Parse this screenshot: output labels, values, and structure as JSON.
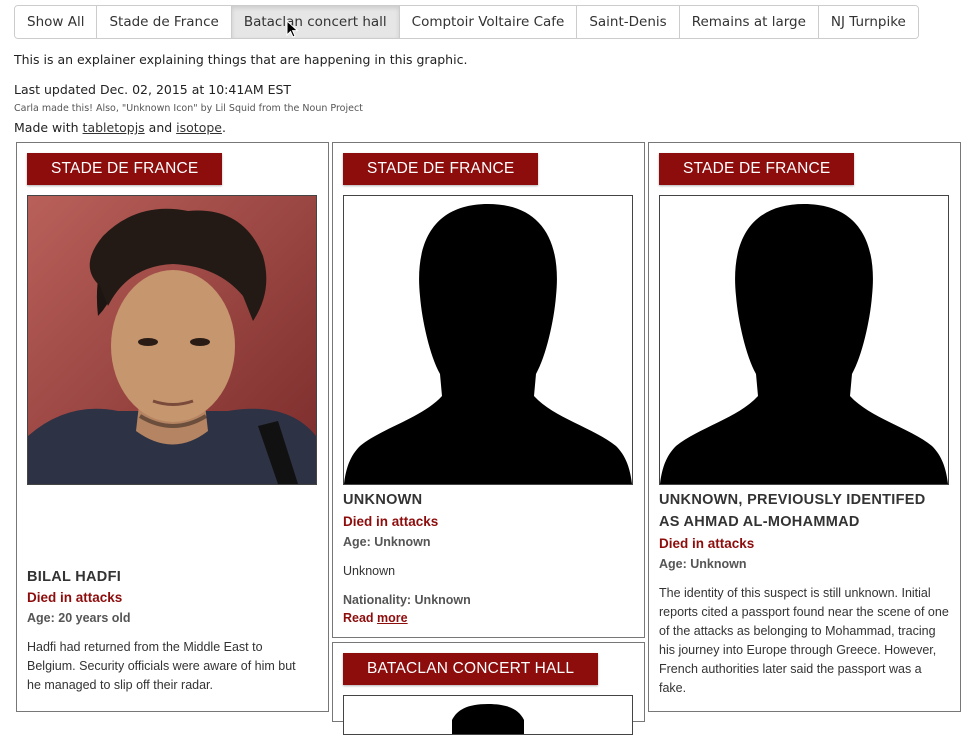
{
  "tabs": [
    {
      "label": "Show All"
    },
    {
      "label": "Stade de France"
    },
    {
      "label": "Bataclan concert hall"
    },
    {
      "label": "Comptoir Voltaire Cafe"
    },
    {
      "label": "Saint-Denis"
    },
    {
      "label": "Remains at large"
    },
    {
      "label": "NJ Turnpike"
    }
  ],
  "intro": "This is an explainer explaining things that are happening in this graphic.",
  "updated": "Last updated Dec. 02, 2015 at 10:41AM EST",
  "credit": "Carla made this! Also, \"Unknown Icon\" by Lil Squid from the Noun Project",
  "madewith": {
    "prefix": "Made with ",
    "link1": "tabletopjs",
    "and": " and ",
    "link2": "isotope",
    "suffix": "."
  },
  "cards": [
    {
      "location": "STADE DE FRANCE",
      "name": "BILAL HADFI",
      "status": "Died in attacks",
      "age": "Age: 20 years old",
      "description": "Hadfi had returned from the Middle East to Belgium. Security officials were aware of him but he managed to slip off their radar."
    },
    {
      "location": "STADE DE FRANCE",
      "name": "UNKNOWN",
      "status": "Died in attacks",
      "age": "Age: Unknown",
      "description": "Unknown",
      "nationality": "Nationality: Unknown",
      "read": "Read ",
      "more": "more"
    },
    {
      "location": "STADE DE FRANCE",
      "name": "UNKNOWN, PREVIOUSLY IDENTIFED AS AHMAD AL-MOHAMMAD",
      "status": "Died in attacks",
      "age": "Age: Unknown",
      "description": "The identity of this suspect is still unknown. Initial reports cited a passport found near the scene of one of the attacks as belonging to Mohammad, tracing his journey into Europe through Greece. However, French authorities later said the passport was a fake."
    },
    {
      "location": "BATACLAN CONCERT HALL"
    }
  ],
  "colors": {
    "accent": "#8d0c0c",
    "tab_active": "#e6e6e6"
  }
}
